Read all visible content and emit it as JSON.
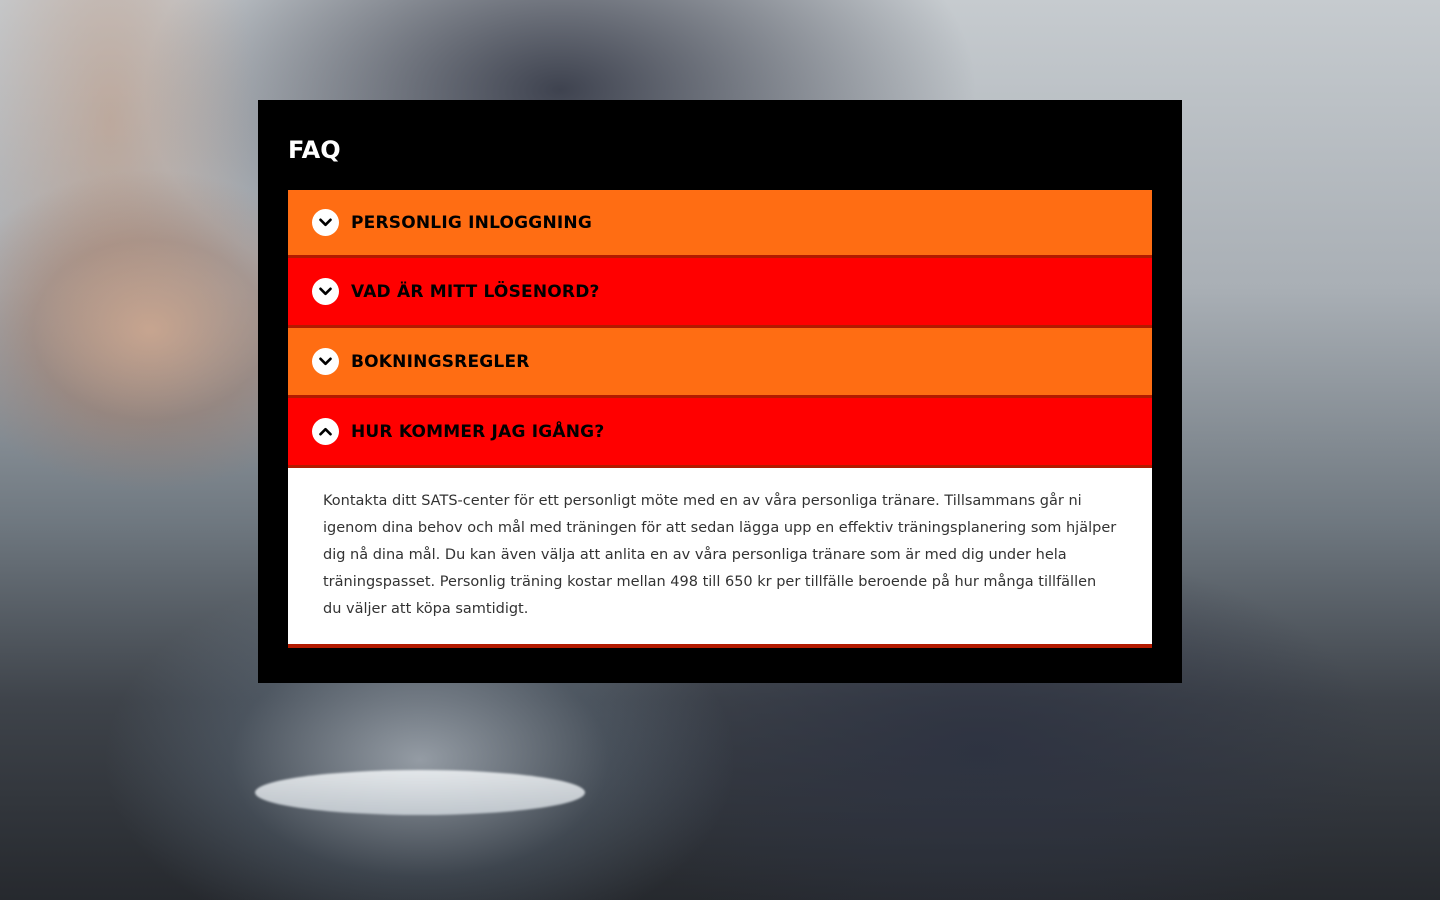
{
  "faq": {
    "title": "FAQ",
    "items": [
      {
        "label": "PERSONLIG INLOGGNING",
        "expanded": false,
        "color": "#ff6d13",
        "icon": "chevron-down-icon"
      },
      {
        "label": "VAD ÄR MITT LÖSENORD?",
        "expanded": false,
        "color": "#ff0000",
        "icon": "chevron-down-icon"
      },
      {
        "label": "BOKNINGSREGLER",
        "expanded": false,
        "color": "#ff6d13",
        "icon": "chevron-down-icon"
      },
      {
        "label": "HUR KOMMER JAG IGÅNG?",
        "expanded": true,
        "color": "#ff0000",
        "icon": "chevron-up-icon",
        "answer": "Kontakta ditt SATS-center för ett personligt möte med en av våra personliga tränare. Tillsammans går ni igenom dina behov och mål med träningen för att sedan lägga upp en effektiv träningsplanering som hjälper dig nå dina mål. Du kan även välja att anlita en av våra personliga tränare som är med dig under hela träningspasset. Personlig träning kostar mellan 498 till 650 kr per tillfälle beroende på hur många tillfällen du väljer att köpa samtidigt."
      }
    ]
  },
  "colors": {
    "panel_background": "#000000",
    "orange": "#ff6d13",
    "red": "#ff0000",
    "divider": "#b31a00"
  }
}
